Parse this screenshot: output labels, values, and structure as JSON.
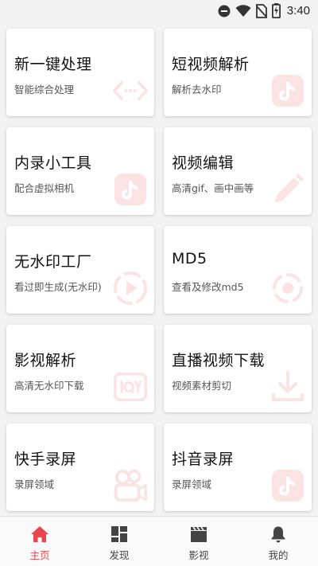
{
  "status_bar": {
    "time": "3:40",
    "icons": [
      "do-not-disturb-icon",
      "wifi-icon",
      "no-sim-icon",
      "battery-charging-icon"
    ]
  },
  "colors": {
    "accent": "#e8474f",
    "icon_faint": "#fbe3e4",
    "nav_inactive": "#444444"
  },
  "cards": [
    {
      "title": "新一键处理",
      "subtitle": "智能综合处理",
      "icon": "code-dots-icon"
    },
    {
      "title": "短视频解析",
      "subtitle": "解析去水印",
      "icon": "tiktok-icon"
    },
    {
      "title": "内录小工具",
      "subtitle": "配合虚拟相机",
      "icon": "tiktok-icon"
    },
    {
      "title": "视频编辑",
      "subtitle": "高清gif、画中画等",
      "icon": "pencil-icon"
    },
    {
      "title": "无水印工厂",
      "subtitle": "看过即生成(无水印)",
      "icon": "play-circle-icon"
    },
    {
      "title": "MD5",
      "subtitle": "查看及修改md5",
      "icon": "target-dashed-icon"
    },
    {
      "title": "影视解析",
      "subtitle": "高清无水印下载",
      "icon": "iqiyi-icon"
    },
    {
      "title": "直播视频下载",
      "subtitle": "视频素材剪切",
      "icon": "download-icon"
    },
    {
      "title": "快手录屏",
      "subtitle": "录屏领域",
      "icon": "video-camera-icon"
    },
    {
      "title": "抖音录屏",
      "subtitle": "录屏领域",
      "icon": "tiktok-icon"
    }
  ],
  "bottom_nav": [
    {
      "label": "主页",
      "icon": "home-icon",
      "active": true
    },
    {
      "label": "发现",
      "icon": "dashboard-icon",
      "active": false
    },
    {
      "label": "影视",
      "icon": "clapperboard-icon",
      "active": false
    },
    {
      "label": "我的",
      "icon": "bell-icon",
      "active": false
    }
  ]
}
